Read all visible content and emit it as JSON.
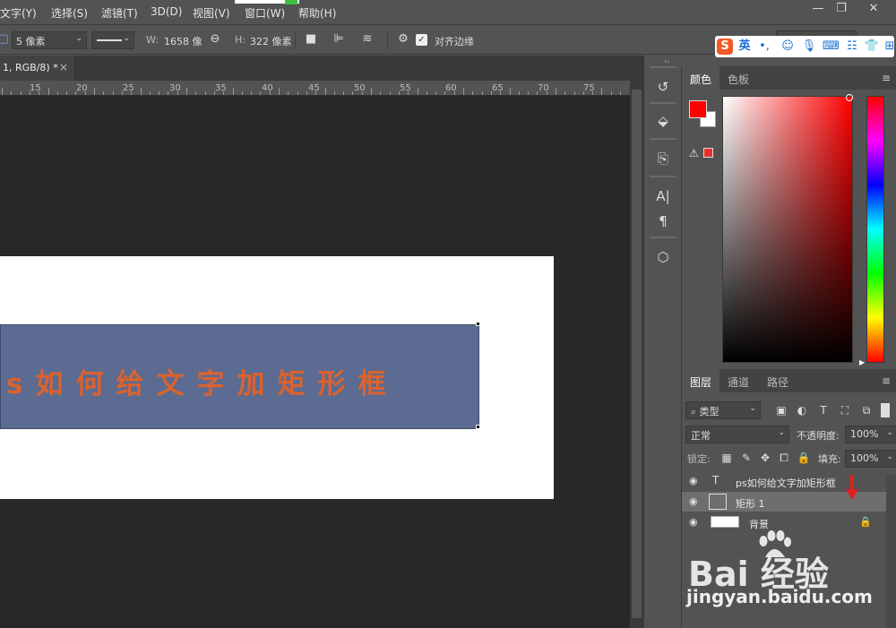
{
  "menubar": {
    "items": [
      "文字(Y)",
      "选择(S)",
      "滤镜(T)",
      "3D(D)",
      "视图(V)",
      "窗口(W)",
      "帮助(H)"
    ],
    "window_controls": [
      "—",
      "❐",
      "✕"
    ]
  },
  "options": {
    "stroke_width": "5 像素",
    "w_label": "W:",
    "w_value": "1658 像",
    "h_label": "H:",
    "h_value": "322 像素",
    "align_edges_label": "对齐边缘",
    "align_edges_checked": true
  },
  "ime": {
    "logo": "S",
    "mode": "英"
  },
  "document": {
    "tab_title": "1, RGB/8) *",
    "close": "×"
  },
  "ruler": {
    "labels": [
      "15",
      "20",
      "25",
      "30",
      "35",
      "40",
      "45",
      "50",
      "55",
      "60",
      "65",
      "70",
      "75"
    ]
  },
  "canvas": {
    "rect_fill": "#5b6b91",
    "text_color": "#d9632f",
    "rect_text": "s如何给文字加矩形框"
  },
  "color_panel": {
    "tabs": [
      "颜色",
      "色板"
    ],
    "active_tab": "颜色",
    "foreground": "#ff0000",
    "background": "#ffffff"
  },
  "layers_panel": {
    "tabs": [
      "图层",
      "通道",
      "路径"
    ],
    "active_tab": "图层",
    "filter_kind": "类型",
    "blend_mode": "正常",
    "opacity_label": "不透明度:",
    "opacity_value": "100%",
    "lock_label": "锁定:",
    "fill_label": "填充:",
    "fill_value": "100%",
    "layers": [
      {
        "name": "ps如何给文字加矩形框",
        "type": "text",
        "selected": false
      },
      {
        "name": "矩形 1",
        "type": "shape",
        "selected": true
      },
      {
        "name": "背景",
        "type": "background",
        "selected": false,
        "locked": true
      }
    ]
  },
  "watermark": {
    "logo": "Bai  经验",
    "url": "jingyan.baidu.com"
  }
}
